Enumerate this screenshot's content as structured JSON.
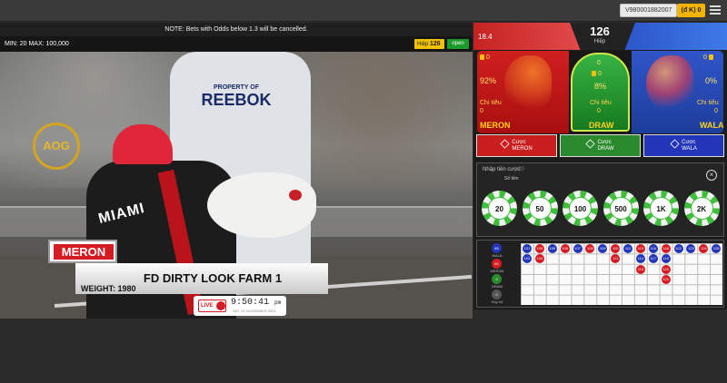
{
  "topbar": {
    "account": "V980001882007",
    "balance": "(đ K) 0",
    "menu_icon": "hamburger-menu-icon"
  },
  "notice": "NOTE: Bets with Odds below 1.3 will be cancelled.",
  "limits": {
    "text": "MIN: 20   MAX: 100,000",
    "hiep_label": "Hiệp",
    "hiep_value": "126",
    "status": "open"
  },
  "video": {
    "logo": "AOG",
    "jersey_text": "MIAMI",
    "shirt_small": "PROPERTY OF",
    "shirt_text": "REEBOK",
    "side_tag": "MERON",
    "fighter_name": "FD DIRTY LOOK FARM 1",
    "weight": "WEIGHT: 1980",
    "live_label": "LIVE",
    "clock": "9:50:41",
    "clock_suffix": "pm",
    "date": "SAT, 22 NOVEMBER 2021"
  },
  "panel": {
    "header": {
      "left_value": "18.4",
      "round": "126",
      "round_label": "Hiệp"
    },
    "meron": {
      "amount": "0",
      "percent": "92%",
      "label": "Chi tiêu",
      "spent": "0",
      "name": "MERON"
    },
    "draw": {
      "amount_top": "0",
      "amount": "0",
      "percent": "8%",
      "label": "Chi tiêu",
      "spent": "0",
      "name": "DRAW"
    },
    "wala": {
      "amount": "0",
      "percent": "0%",
      "label": "Chi tiêu",
      "spent": "0",
      "name": "WALA"
    },
    "buttons": {
      "meron": {
        "line1": "Cược",
        "line2": "MERON"
      },
      "draw": {
        "line1": "Cược",
        "line2": "DRAW"
      },
      "wala": {
        "line1": "Cược",
        "line2": "WALA"
      }
    },
    "stake": {
      "label": "Nhập tiền cược",
      "sub_label": "Số tiền",
      "value": "20"
    },
    "chips": [
      "20",
      "50",
      "100",
      "500",
      "1K",
      "2K"
    ],
    "legend": [
      {
        "count": "65",
        "label": "WALA",
        "color": "#2335b8"
      },
      {
        "count": "60",
        "label": "MERON",
        "color": "#d51b24"
      },
      {
        "count": "0",
        "label": "DRAW",
        "color": "#2a8a2d"
      },
      {
        "count": "0",
        "label": "Hủy bỏ",
        "color": "#555555"
      }
    ],
    "road": [
      {
        "c": 0,
        "r": 0,
        "t": "b",
        "v": "101"
      },
      {
        "c": 0,
        "r": 1,
        "t": "b",
        "v": "102"
      },
      {
        "c": 1,
        "r": 0,
        "t": "r",
        "v": "103"
      },
      {
        "c": 1,
        "r": 1,
        "t": "r",
        "v": "104"
      },
      {
        "c": 2,
        "r": 0,
        "t": "b",
        "v": "105"
      },
      {
        "c": 3,
        "r": 0,
        "t": "r",
        "v": "106"
      },
      {
        "c": 4,
        "r": 0,
        "t": "b",
        "v": "107"
      },
      {
        "c": 5,
        "r": 0,
        "t": "r",
        "v": "108"
      },
      {
        "c": 6,
        "r": 0,
        "t": "b",
        "v": "109"
      },
      {
        "c": 7,
        "r": 0,
        "t": "r",
        "v": "110"
      },
      {
        "c": 7,
        "r": 1,
        "t": "r",
        "v": "111"
      },
      {
        "c": 8,
        "r": 0,
        "t": "b",
        "v": "112"
      },
      {
        "c": 9,
        "r": 0,
        "t": "r",
        "v": "113"
      },
      {
        "c": 9,
        "r": 1,
        "t": "b",
        "v": "114"
      },
      {
        "c": 9,
        "r": 2,
        "t": "r",
        "v": "115"
      },
      {
        "c": 10,
        "r": 0,
        "t": "b",
        "v": "116"
      },
      {
        "c": 10,
        "r": 1,
        "t": "b",
        "v": "117"
      },
      {
        "c": 11,
        "r": 0,
        "t": "r",
        "v": "118"
      },
      {
        "c": 11,
        "r": 1,
        "t": "b",
        "v": "119"
      },
      {
        "c": 11,
        "r": 2,
        "t": "r",
        "v": "120"
      },
      {
        "c": 11,
        "r": 3,
        "t": "r",
        "v": "121"
      },
      {
        "c": 12,
        "r": 0,
        "t": "b",
        "v": "122"
      },
      {
        "c": 13,
        "r": 0,
        "t": "b",
        "v": "123"
      },
      {
        "c": 14,
        "r": 0,
        "t": "r",
        "v": "124"
      },
      {
        "c": 15,
        "r": 0,
        "t": "b",
        "v": "125"
      }
    ]
  }
}
